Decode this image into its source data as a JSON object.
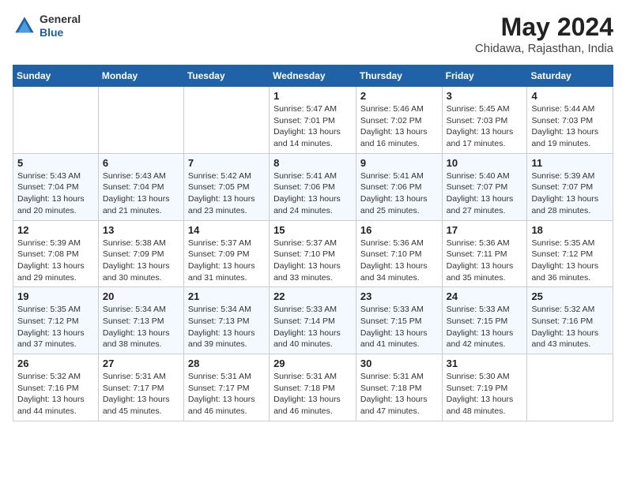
{
  "header": {
    "logo_line1": "General",
    "logo_line2": "Blue",
    "month_year": "May 2024",
    "location": "Chidawa, Rajasthan, India"
  },
  "weekdays": [
    "Sunday",
    "Monday",
    "Tuesday",
    "Wednesday",
    "Thursday",
    "Friday",
    "Saturday"
  ],
  "weeks": [
    [
      {
        "day": "",
        "sunrise": "",
        "sunset": "",
        "daylight": ""
      },
      {
        "day": "",
        "sunrise": "",
        "sunset": "",
        "daylight": ""
      },
      {
        "day": "",
        "sunrise": "",
        "sunset": "",
        "daylight": ""
      },
      {
        "day": "1",
        "sunrise": "Sunrise: 5:47 AM",
        "sunset": "Sunset: 7:01 PM",
        "daylight": "Daylight: 13 hours and 14 minutes."
      },
      {
        "day": "2",
        "sunrise": "Sunrise: 5:46 AM",
        "sunset": "Sunset: 7:02 PM",
        "daylight": "Daylight: 13 hours and 16 minutes."
      },
      {
        "day": "3",
        "sunrise": "Sunrise: 5:45 AM",
        "sunset": "Sunset: 7:03 PM",
        "daylight": "Daylight: 13 hours and 17 minutes."
      },
      {
        "day": "4",
        "sunrise": "Sunrise: 5:44 AM",
        "sunset": "Sunset: 7:03 PM",
        "daylight": "Daylight: 13 hours and 19 minutes."
      }
    ],
    [
      {
        "day": "5",
        "sunrise": "Sunrise: 5:43 AM",
        "sunset": "Sunset: 7:04 PM",
        "daylight": "Daylight: 13 hours and 20 minutes."
      },
      {
        "day": "6",
        "sunrise": "Sunrise: 5:43 AM",
        "sunset": "Sunset: 7:04 PM",
        "daylight": "Daylight: 13 hours and 21 minutes."
      },
      {
        "day": "7",
        "sunrise": "Sunrise: 5:42 AM",
        "sunset": "Sunset: 7:05 PM",
        "daylight": "Daylight: 13 hours and 23 minutes."
      },
      {
        "day": "8",
        "sunrise": "Sunrise: 5:41 AM",
        "sunset": "Sunset: 7:06 PM",
        "daylight": "Daylight: 13 hours and 24 minutes."
      },
      {
        "day": "9",
        "sunrise": "Sunrise: 5:41 AM",
        "sunset": "Sunset: 7:06 PM",
        "daylight": "Daylight: 13 hours and 25 minutes."
      },
      {
        "day": "10",
        "sunrise": "Sunrise: 5:40 AM",
        "sunset": "Sunset: 7:07 PM",
        "daylight": "Daylight: 13 hours and 27 minutes."
      },
      {
        "day": "11",
        "sunrise": "Sunrise: 5:39 AM",
        "sunset": "Sunset: 7:07 PM",
        "daylight": "Daylight: 13 hours and 28 minutes."
      }
    ],
    [
      {
        "day": "12",
        "sunrise": "Sunrise: 5:39 AM",
        "sunset": "Sunset: 7:08 PM",
        "daylight": "Daylight: 13 hours and 29 minutes."
      },
      {
        "day": "13",
        "sunrise": "Sunrise: 5:38 AM",
        "sunset": "Sunset: 7:09 PM",
        "daylight": "Daylight: 13 hours and 30 minutes."
      },
      {
        "day": "14",
        "sunrise": "Sunrise: 5:37 AM",
        "sunset": "Sunset: 7:09 PM",
        "daylight": "Daylight: 13 hours and 31 minutes."
      },
      {
        "day": "15",
        "sunrise": "Sunrise: 5:37 AM",
        "sunset": "Sunset: 7:10 PM",
        "daylight": "Daylight: 13 hours and 33 minutes."
      },
      {
        "day": "16",
        "sunrise": "Sunrise: 5:36 AM",
        "sunset": "Sunset: 7:10 PM",
        "daylight": "Daylight: 13 hours and 34 minutes."
      },
      {
        "day": "17",
        "sunrise": "Sunrise: 5:36 AM",
        "sunset": "Sunset: 7:11 PM",
        "daylight": "Daylight: 13 hours and 35 minutes."
      },
      {
        "day": "18",
        "sunrise": "Sunrise: 5:35 AM",
        "sunset": "Sunset: 7:12 PM",
        "daylight": "Daylight: 13 hours and 36 minutes."
      }
    ],
    [
      {
        "day": "19",
        "sunrise": "Sunrise: 5:35 AM",
        "sunset": "Sunset: 7:12 PM",
        "daylight": "Daylight: 13 hours and 37 minutes."
      },
      {
        "day": "20",
        "sunrise": "Sunrise: 5:34 AM",
        "sunset": "Sunset: 7:13 PM",
        "daylight": "Daylight: 13 hours and 38 minutes."
      },
      {
        "day": "21",
        "sunrise": "Sunrise: 5:34 AM",
        "sunset": "Sunset: 7:13 PM",
        "daylight": "Daylight: 13 hours and 39 minutes."
      },
      {
        "day": "22",
        "sunrise": "Sunrise: 5:33 AM",
        "sunset": "Sunset: 7:14 PM",
        "daylight": "Daylight: 13 hours and 40 minutes."
      },
      {
        "day": "23",
        "sunrise": "Sunrise: 5:33 AM",
        "sunset": "Sunset: 7:15 PM",
        "daylight": "Daylight: 13 hours and 41 minutes."
      },
      {
        "day": "24",
        "sunrise": "Sunrise: 5:33 AM",
        "sunset": "Sunset: 7:15 PM",
        "daylight": "Daylight: 13 hours and 42 minutes."
      },
      {
        "day": "25",
        "sunrise": "Sunrise: 5:32 AM",
        "sunset": "Sunset: 7:16 PM",
        "daylight": "Daylight: 13 hours and 43 minutes."
      }
    ],
    [
      {
        "day": "26",
        "sunrise": "Sunrise: 5:32 AM",
        "sunset": "Sunset: 7:16 PM",
        "daylight": "Daylight: 13 hours and 44 minutes."
      },
      {
        "day": "27",
        "sunrise": "Sunrise: 5:31 AM",
        "sunset": "Sunset: 7:17 PM",
        "daylight": "Daylight: 13 hours and 45 minutes."
      },
      {
        "day": "28",
        "sunrise": "Sunrise: 5:31 AM",
        "sunset": "Sunset: 7:17 PM",
        "daylight": "Daylight: 13 hours and 46 minutes."
      },
      {
        "day": "29",
        "sunrise": "Sunrise: 5:31 AM",
        "sunset": "Sunset: 7:18 PM",
        "daylight": "Daylight: 13 hours and 46 minutes."
      },
      {
        "day": "30",
        "sunrise": "Sunrise: 5:31 AM",
        "sunset": "Sunset: 7:18 PM",
        "daylight": "Daylight: 13 hours and 47 minutes."
      },
      {
        "day": "31",
        "sunrise": "Sunrise: 5:30 AM",
        "sunset": "Sunset: 7:19 PM",
        "daylight": "Daylight: 13 hours and 48 minutes."
      },
      {
        "day": "",
        "sunrise": "",
        "sunset": "",
        "daylight": ""
      }
    ]
  ]
}
